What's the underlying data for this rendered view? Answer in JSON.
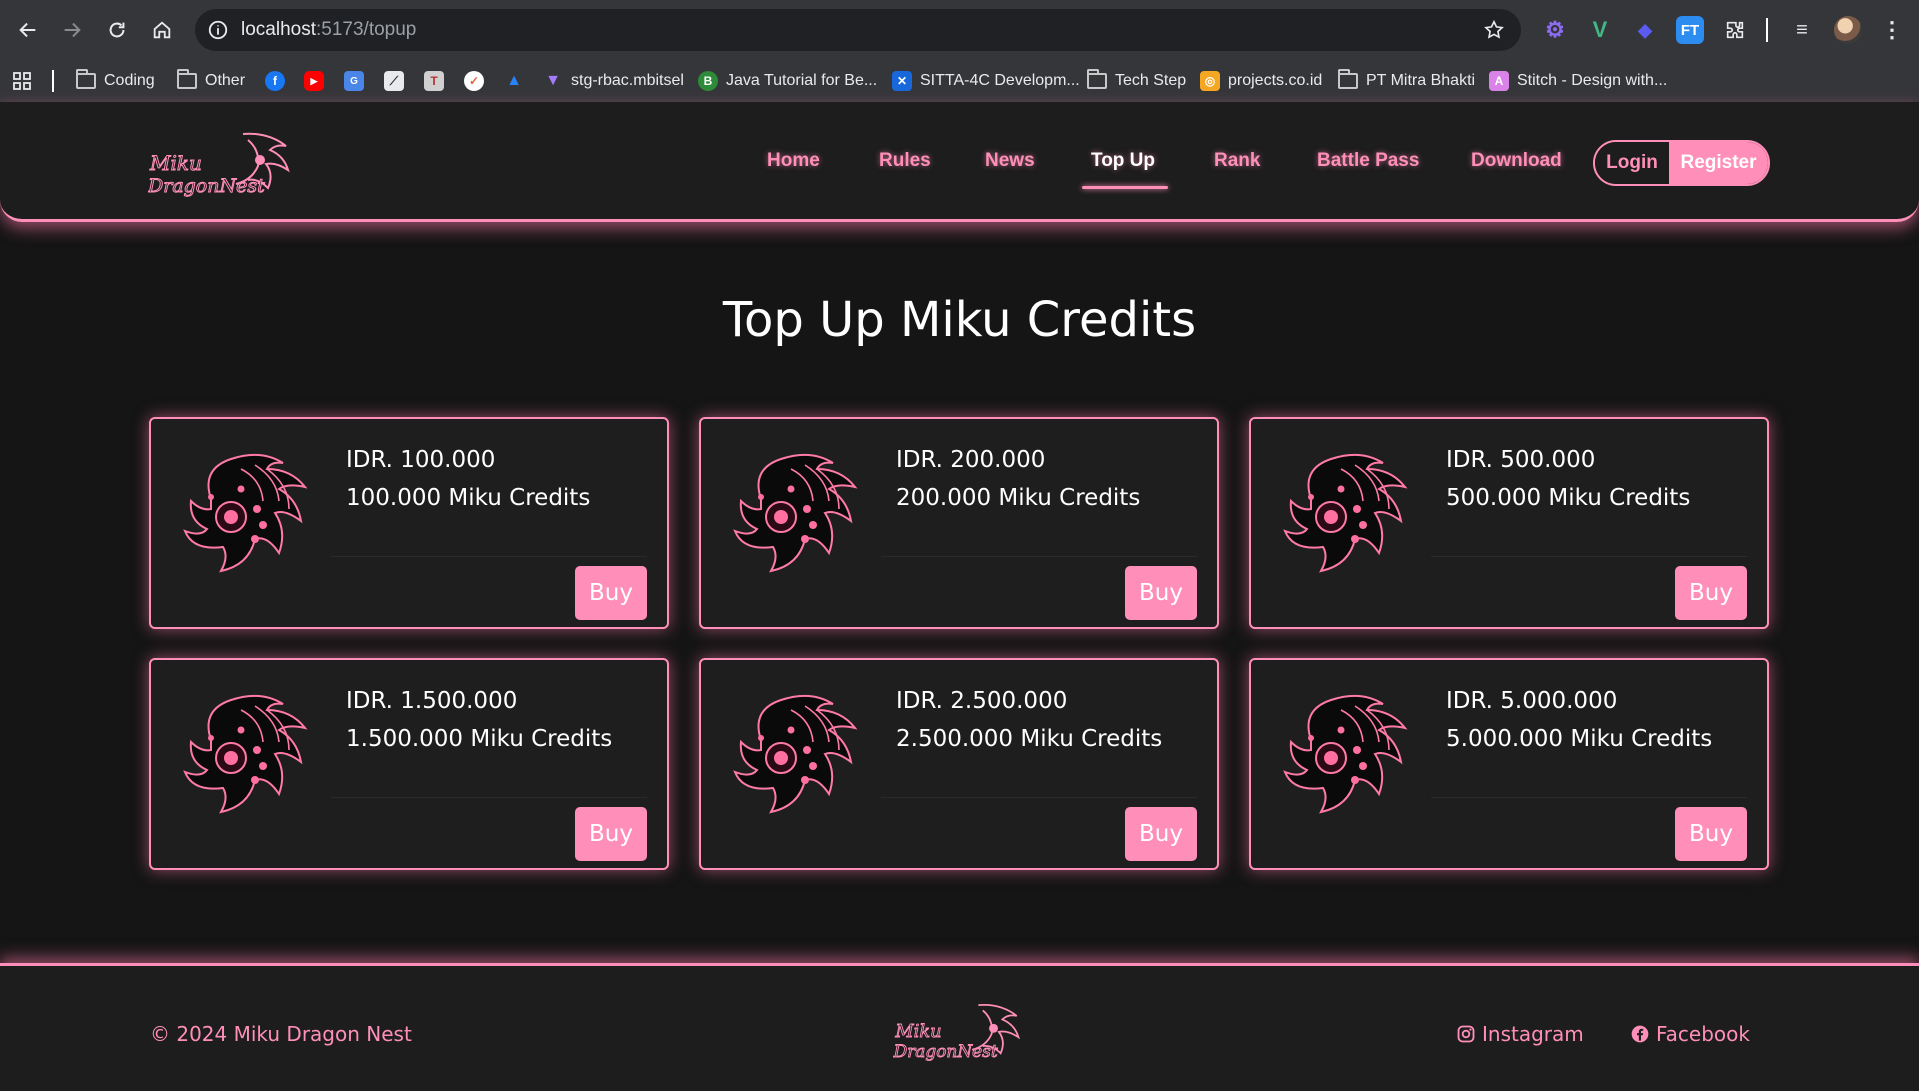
{
  "browser": {
    "url_host": "localhost",
    "url_path": ":5173/topup",
    "bookmarks": [
      {
        "label": "Coding",
        "icon": "folder-icon"
      },
      {
        "label": "Other",
        "icon": "folder-icon"
      },
      {
        "label": "",
        "icon": "facebook-icon"
      },
      {
        "label": "",
        "icon": "youtube-icon"
      },
      {
        "label": "",
        "icon": "translate-icon"
      },
      {
        "label": "",
        "icon": "blank-icon"
      },
      {
        "label": "",
        "icon": "tools-icon"
      },
      {
        "label": "",
        "icon": "app-icon"
      },
      {
        "label": "",
        "icon": "jira-icon"
      },
      {
        "label": "stg-rbac.mbitsel",
        "icon": "vite-icon"
      },
      {
        "label": "Java Tutorial for Be...",
        "icon": "java-icon"
      },
      {
        "label": "SITTA-4C Developm...",
        "icon": "confluence-icon"
      },
      {
        "label": "Tech Step",
        "icon": "folder-icon"
      },
      {
        "label": "projects.co.id",
        "icon": "projects-icon"
      },
      {
        "label": "PT Mitra Bhakti",
        "icon": "folder-icon"
      },
      {
        "label": "Stitch - Design with...",
        "icon": "stitch-icon"
      }
    ]
  },
  "header": {
    "nav": [
      {
        "label": "Home",
        "active": false
      },
      {
        "label": "Rules",
        "active": false
      },
      {
        "label": "News",
        "active": false
      },
      {
        "label": "Top Up",
        "active": true
      },
      {
        "label": "Rank",
        "active": false
      },
      {
        "label": "Battle Pass",
        "active": false
      },
      {
        "label": "Download",
        "active": false
      }
    ],
    "login_label": "Login",
    "register_label": "Register"
  },
  "main": {
    "title": "Top Up Miku Credits",
    "packages": [
      {
        "price": "IDR. 100.000",
        "credits": "100.000 Miku Credits",
        "buy_label": "Buy"
      },
      {
        "price": "IDR. 200.000",
        "credits": "200.000 Miku Credits",
        "buy_label": "Buy"
      },
      {
        "price": "IDR. 500.000",
        "credits": "500.000 Miku Credits",
        "buy_label": "Buy"
      },
      {
        "price": "IDR. 1.500.000",
        "credits": "1.500.000 Miku Credits",
        "buy_label": "Buy"
      },
      {
        "price": "IDR. 2.500.000",
        "credits": "2.500.000 Miku Credits",
        "buy_label": "Buy"
      },
      {
        "price": "IDR. 5.000.000",
        "credits": "5.000.000 Miku Credits",
        "buy_label": "Buy"
      }
    ]
  },
  "footer": {
    "copyright": "© 2024 Miku Dragon Nest",
    "instagram_label": "Instagram",
    "facebook_label": "Facebook"
  },
  "colors": {
    "accent": "#ff8fb8",
    "background": "#151515",
    "card": "#1e1e1e"
  }
}
